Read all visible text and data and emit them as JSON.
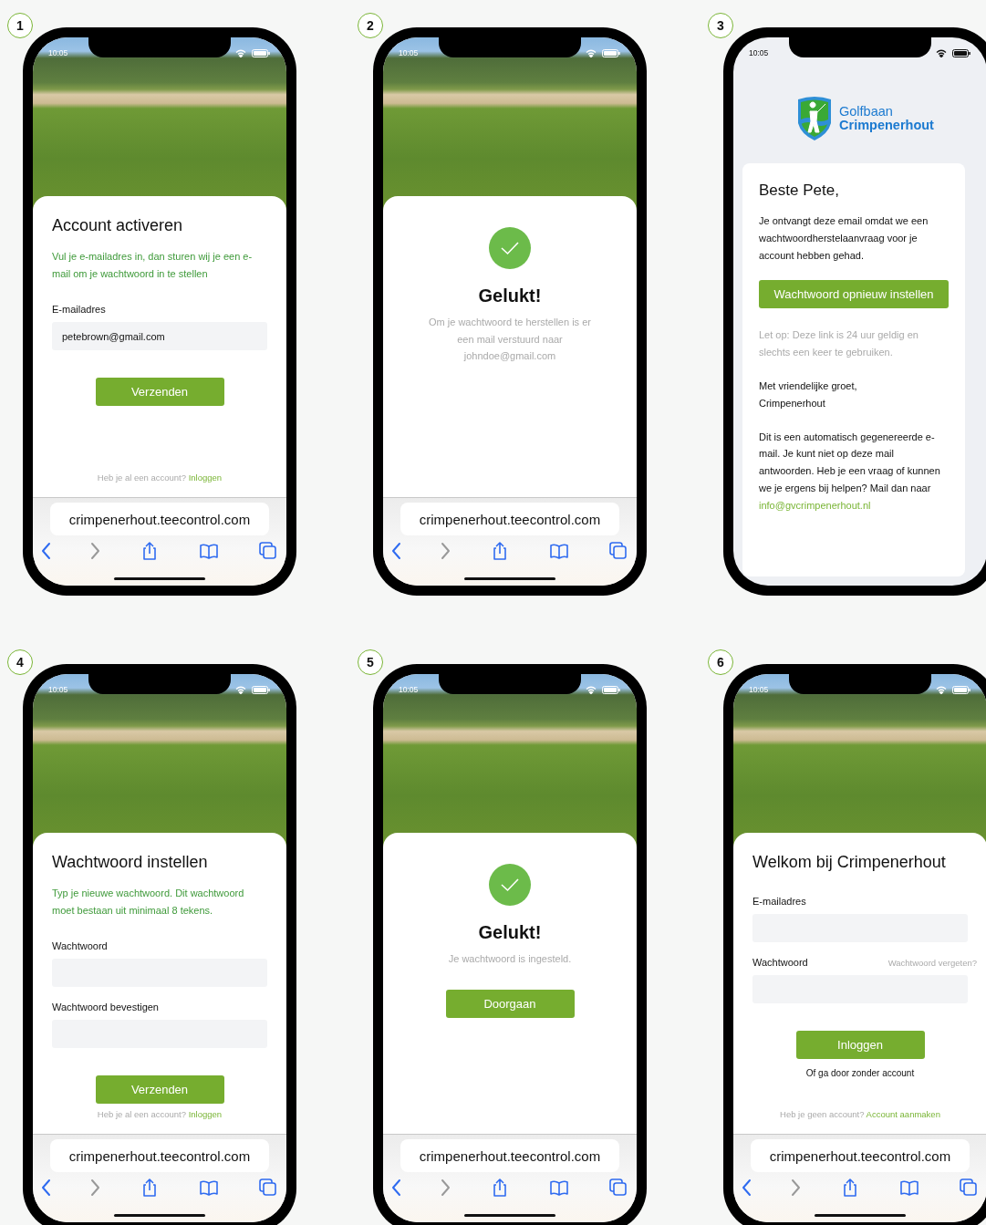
{
  "screens": [
    {
      "number": "1",
      "kind": "form",
      "time": "10:05",
      "title": "Account activeren",
      "intro": "Vul je e-mailadres in, dan sturen wij je een e-mail om je wachtwoord in te stellen",
      "fields": [
        {
          "label": "E-mailadres",
          "value": "petebrown@gmail.com"
        }
      ],
      "button": "Verzenden",
      "footer": {
        "text": "Heb je al een account?",
        "link": "Inloggen"
      },
      "url": "crimpenerhout.teecontrol.com"
    },
    {
      "number": "2",
      "kind": "success",
      "time": "10:05",
      "title": "Gelukt!",
      "message": "Om je wachtwoord te herstellen is er een mail verstuurd naar johndoe@gmail.com",
      "url": "crimpenerhout.teecontrol.com"
    },
    {
      "number": "3",
      "kind": "email",
      "time": "10:05",
      "logo": {
        "line1": "Golfbaan",
        "line2": "Crimpenerhout"
      },
      "greeting": "Beste Pete,",
      "body": [
        {
          "kind": "text",
          "text": "Je ontvangt deze email omdat we een wachtwoordherstelaanvraag voor je account hebben gehad."
        },
        {
          "kind": "button",
          "text": "Wachtwoord opnieuw instellen"
        },
        {
          "kind": "note",
          "text": "Let op: Deze link is 24 uur geldig en slechts een keer te gebruiken."
        },
        {
          "kind": "lines",
          "lines": [
            "Met vriendelijke groet,",
            "Crimpenerhout"
          ]
        },
        {
          "kind": "text",
          "text": "Dit is een automatisch gegenereerde e-mail. Je kunt niet op deze mail antwoorden. Heb je een vraag of kunnen we je ergens bij helpen? Mail dan naar",
          "link": "info@gvcrimpenerhout.nl"
        }
      ]
    },
    {
      "number": "4",
      "kind": "form",
      "time": "10:05",
      "title": "Wachtwoord instellen",
      "intro": "Typ je nieuwe wachtwoord. Dit wachtwoord moet bestaan uit minimaal 8 tekens.",
      "fields": [
        {
          "label": "Wachtwoord"
        },
        {
          "label": "Wachtwoord bevestigen"
        }
      ],
      "button": "Verzenden",
      "footer": {
        "text": "Heb je al een account?",
        "link": "Inloggen"
      },
      "url": "crimpenerhout.teecontrol.com"
    },
    {
      "number": "5",
      "kind": "success",
      "time": "10:05",
      "title": "Gelukt!",
      "message": "Je wachtwoord is ingesteld.",
      "button": "Doorgaan",
      "url": "crimpenerhout.teecontrol.com"
    },
    {
      "number": "6",
      "kind": "form",
      "time": "10:05",
      "title": "Welkom bij Crimpenerhout",
      "fields": [
        {
          "label": "E-mailadres"
        },
        {
          "label": "Wachtwoord",
          "link": "Wachtwoord vergeten?"
        }
      ],
      "button": "Inloggen",
      "secondary": "Of ga door zonder account",
      "footer": {
        "text": "Heb je geen account?",
        "link": "Account aanmaken"
      },
      "url": "crimpenerhout.teecontrol.com"
    }
  ],
  "toolbar": [
    {
      "kind": "back",
      "disabled": false
    },
    {
      "kind": "forward",
      "disabled": true
    },
    {
      "kind": "share",
      "disabled": false
    },
    {
      "kind": "bookmarks",
      "disabled": false
    },
    {
      "kind": "tabs",
      "disabled": false
    }
  ]
}
